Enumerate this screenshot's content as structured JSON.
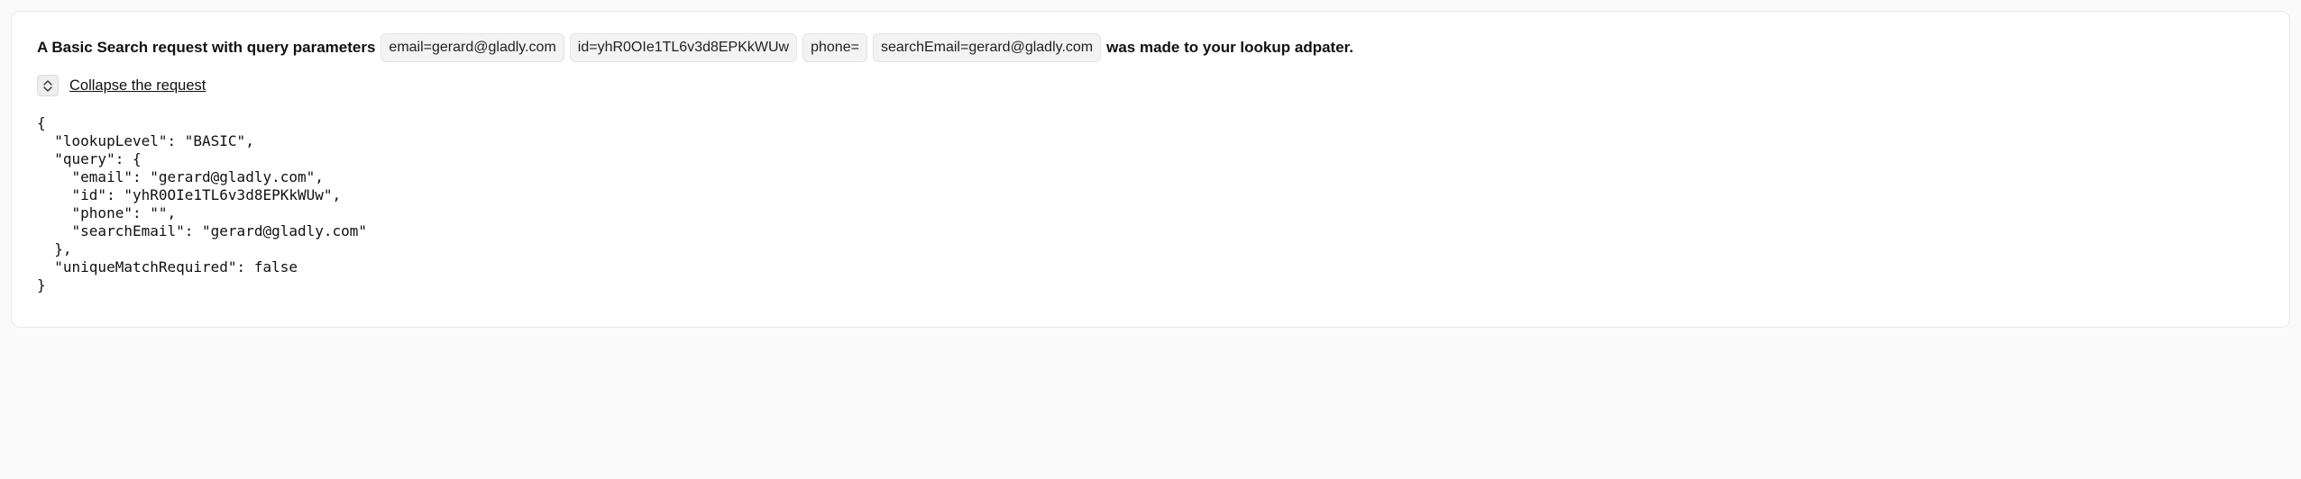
{
  "header": {
    "prefix": "A Basic Search request with query parameters",
    "chips": [
      "email=gerard@gladly.com",
      "id=yhR0OIe1TL6v3d8EPKkWUw",
      "phone=",
      "searchEmail=gerard@gladly.com"
    ],
    "suffix": "was made to your lookup adpater."
  },
  "collapse": {
    "label": "Collapse the request"
  },
  "request_json_text": "{\n  \"lookupLevel\": \"BASIC\",\n  \"query\": {\n    \"email\": \"gerard@gladly.com\",\n    \"id\": \"yhR0OIe1TL6v3d8EPKkWUw\",\n    \"phone\": \"\",\n    \"searchEmail\": \"gerard@gladly.com\"\n  },\n  \"uniqueMatchRequired\": false\n}"
}
